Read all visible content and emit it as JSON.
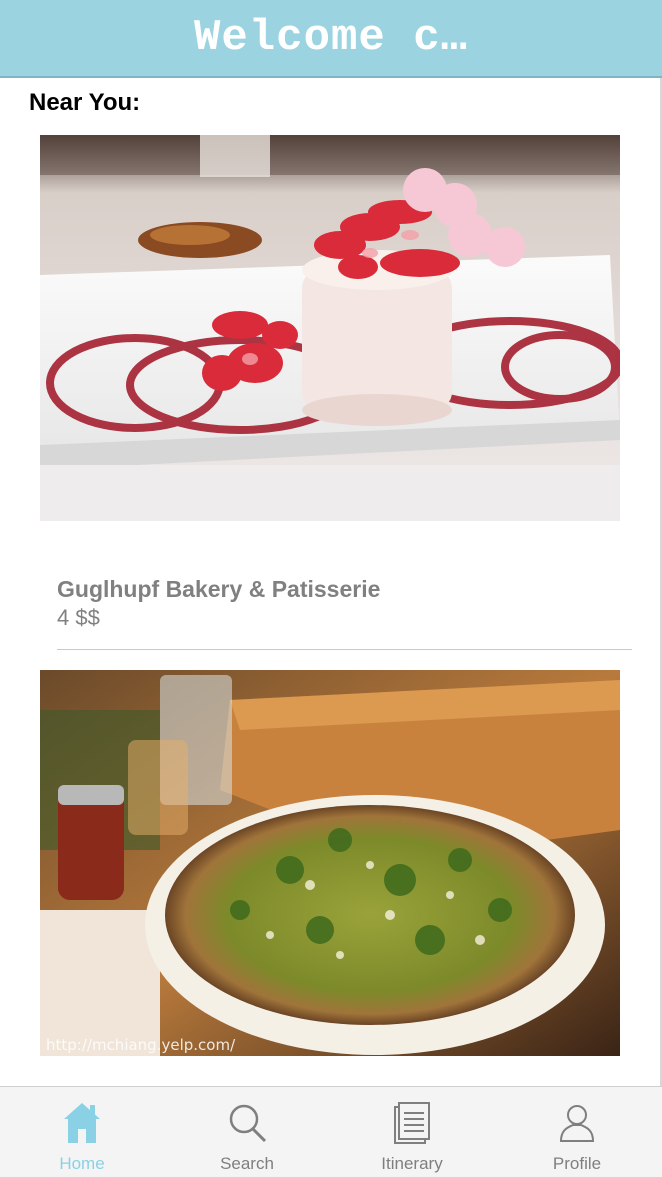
{
  "header": {
    "title": "Welcome c…"
  },
  "section": {
    "heading": "Near You:"
  },
  "listings": [
    {
      "name": "Guglhupf Bakery & Patisserie",
      "meta": "4 $$",
      "image_desc": "strawberry-mousse-dessert-photo"
    },
    {
      "name": "",
      "meta": "",
      "watermark": "http://mchiang.yelp.com/",
      "image_desc": "green-pizza-photo"
    }
  ],
  "tabbar": {
    "tabs": [
      {
        "label": "Home",
        "icon": "home-icon",
        "active": true
      },
      {
        "label": "Search",
        "icon": "search-icon",
        "active": false
      },
      {
        "label": "Itinerary",
        "icon": "itinerary-icon",
        "active": false
      },
      {
        "label": "Profile",
        "icon": "profile-icon",
        "active": false
      }
    ]
  },
  "colors": {
    "header_bg": "#9bd3e1",
    "accent": "#8ad1e5",
    "muted_text": "#808080"
  }
}
